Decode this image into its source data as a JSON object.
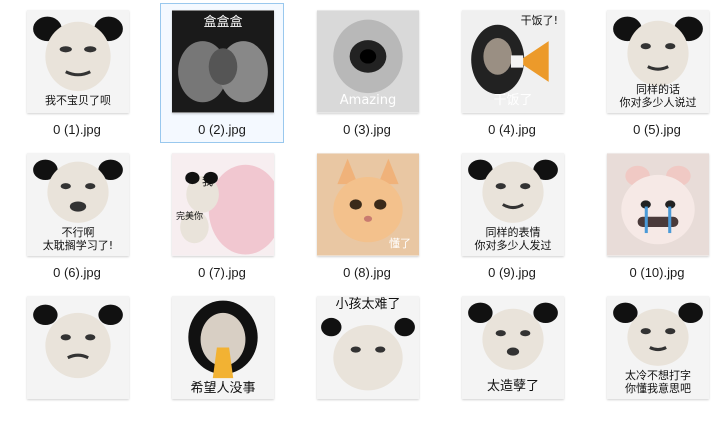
{
  "files": [
    {
      "name": "0 (1).jpg",
      "caption": "我不宝贝了呗",
      "kind": "panda"
    },
    {
      "name": "0 (2).jpg",
      "caption": "盒盒盒",
      "kind": "hands"
    },
    {
      "name": "0 (3).jpg",
      "caption": "Amazing",
      "kind": "blur"
    },
    {
      "name": "0 (4).jpg",
      "caption": "干饭了",
      "caption_top": "干饭了!",
      "kind": "horn"
    },
    {
      "name": "0 (5).jpg",
      "caption": "同样的话\n你对多少人说过",
      "kind": "panda"
    },
    {
      "name": "0 (6).jpg",
      "caption": "不行啊\n太耽搁学习了!",
      "kind": "panda"
    },
    {
      "name": "0 (7).jpg",
      "caption": "我",
      "caption_side": "完美你",
      "kind": "pink"
    },
    {
      "name": "0 (8).jpg",
      "caption": "懂了",
      "kind": "cat"
    },
    {
      "name": "0 (9).jpg",
      "caption": "同样的表情\n你对多少人发过",
      "kind": "panda"
    },
    {
      "name": "0 (10).jpg",
      "caption": "",
      "kind": "mouse"
    },
    {
      "name": "",
      "caption": "",
      "kind": "panda"
    },
    {
      "name": "",
      "caption": "希望人没事",
      "kind": "pray"
    },
    {
      "name": "",
      "caption": "小孩太难了",
      "kind": "panda"
    },
    {
      "name": "",
      "caption": "太造孽了",
      "kind": "panda"
    },
    {
      "name": "",
      "caption": "太冷不想打字\n你懂我意思吧",
      "kind": "panda"
    }
  ]
}
